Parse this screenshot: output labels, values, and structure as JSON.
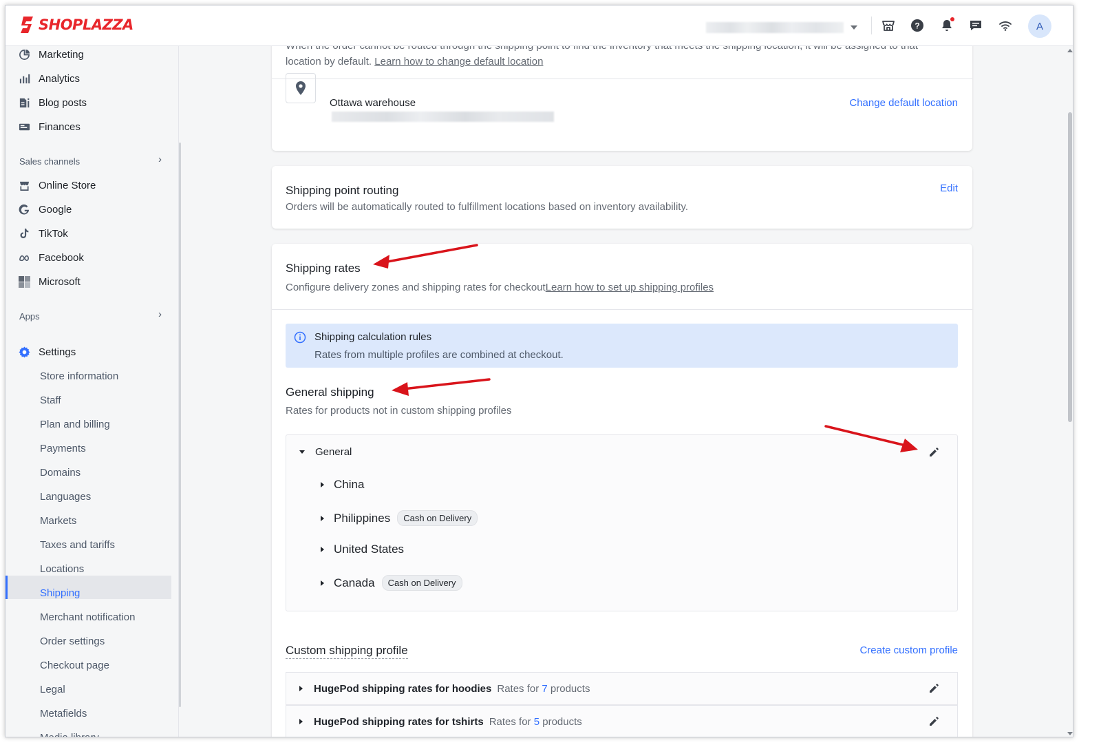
{
  "header": {
    "logo_text": "SHOPLAZZA",
    "avatar_initial": "A",
    "icons": [
      "online-store-icon",
      "help-icon",
      "notification-bell-icon",
      "messages-icon",
      "wifi-icon"
    ]
  },
  "sidebar": {
    "top_items": [
      {
        "label": "Marketing",
        "icon": "marketing-icon"
      },
      {
        "label": "Analytics",
        "icon": "analytics-icon"
      },
      {
        "label": "Blog posts",
        "icon": "blog-icon"
      },
      {
        "label": "Finances",
        "icon": "finances-icon"
      }
    ],
    "sales_channels_label": "Sales channels",
    "channels": [
      {
        "label": "Online Store",
        "icon": "store-icon"
      },
      {
        "label": "Google",
        "icon": "google-icon"
      },
      {
        "label": "TikTok",
        "icon": "tiktok-icon"
      },
      {
        "label": "Facebook",
        "icon": "meta-icon"
      },
      {
        "label": "Microsoft",
        "icon": "microsoft-icon"
      }
    ],
    "apps_label": "Apps",
    "settings_label": "Settings",
    "settings_items": [
      "Store information",
      "Staff",
      "Plan and billing",
      "Payments",
      "Domains",
      "Languages",
      "Markets",
      "Taxes and tariffs",
      "Locations",
      "Shipping",
      "Merchant notification",
      "Order settings",
      "Checkout page",
      "Legal",
      "Metafields",
      "Media library"
    ],
    "active_item": "Shipping"
  },
  "default_location": {
    "description_partial": "When the order cannot be routed through the shipping point to find the inventory that meets the shipping location, it will be assigned to that",
    "description_line2": "location by default.",
    "learn_link": "Learn how to change default location",
    "location_name": "Ottawa warehouse",
    "change_link": "Change default location"
  },
  "routing": {
    "title": "Shipping point routing",
    "description": "Orders will be automatically routed to fulfillment locations based on inventory availability.",
    "edit_label": "Edit"
  },
  "shipping_rates": {
    "title": "Shipping rates",
    "description": "Configure delivery zones and shipping rates for checkout",
    "learn_link": "Learn how to set up shipping profiles",
    "info_title": "Shipping calculation rules",
    "info_text": "Rates from multiple profiles are combined at checkout.",
    "general_title": "General shipping",
    "general_description": "Rates for products not in custom shipping profiles",
    "general_profile_name": "General",
    "countries": [
      {
        "name": "China",
        "badge": ""
      },
      {
        "name": "Philippines",
        "badge": "Cash on Delivery"
      },
      {
        "name": "United States",
        "badge": ""
      },
      {
        "name": "Canada",
        "badge": "Cash on Delivery"
      }
    ],
    "custom_title": "Custom shipping profile",
    "create_custom_link": "Create custom profile",
    "custom_profiles": [
      {
        "name": "HugePod shipping rates for hoodies",
        "rates_prefix": "Rates for",
        "count": "7",
        "rates_suffix": "products"
      },
      {
        "name": "HugePod shipping rates for tshirts",
        "rates_prefix": "Rates for",
        "count": "5",
        "rates_suffix": "products"
      }
    ]
  },
  "colors": {
    "brand": "#e8262b",
    "link": "#3370ff",
    "annotation_arrow": "#d9141b",
    "info_bg": "#dce8fc"
  }
}
